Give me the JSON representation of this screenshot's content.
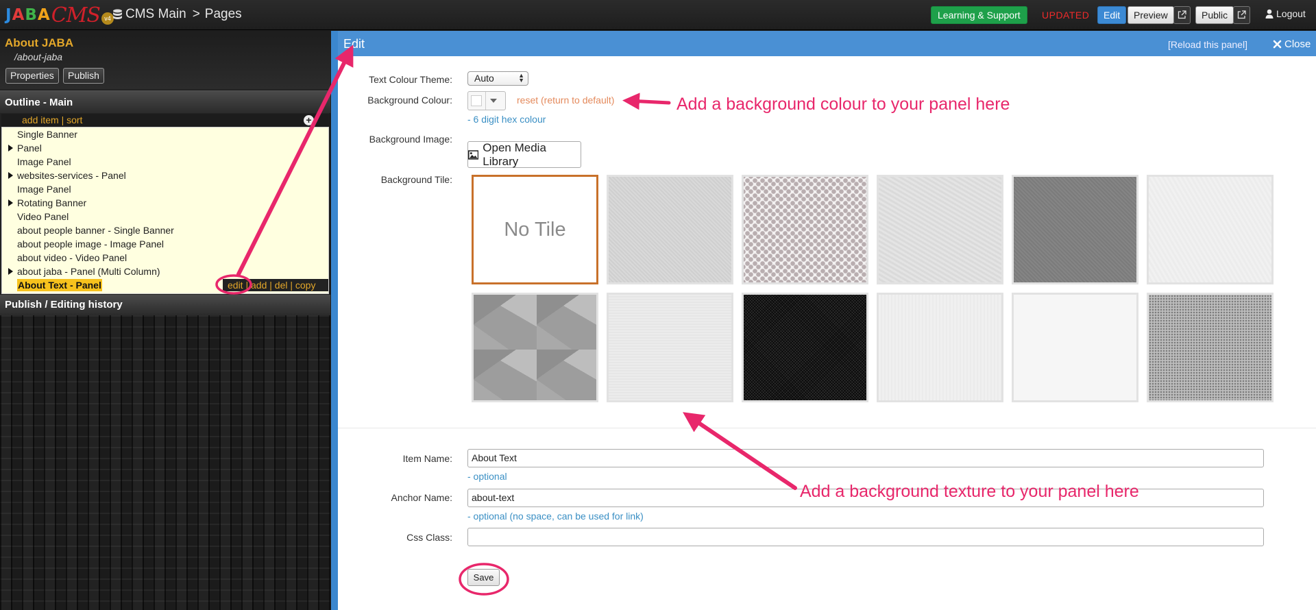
{
  "topbar": {
    "logo": {
      "jaba": "JABA",
      "cms": "CMS",
      "version": "v4"
    },
    "breadcrumb": {
      "section": "CMS Main",
      "separator": ">",
      "current": "Pages"
    },
    "learning_label": "Learning & Support",
    "status": "UPDATED",
    "edit_label": "Edit",
    "preview_label": "Preview",
    "public_label": "Public",
    "logout_label": "Logout"
  },
  "sidebar": {
    "page_title": "About JABA",
    "page_path": "/about-jaba",
    "properties_label": "Properties",
    "publish_label": "Publish",
    "outline_title": "Outline - Main",
    "outline_tools": "add item | sort",
    "items": [
      {
        "label": "Single Banner",
        "expandable": false
      },
      {
        "label": "Panel",
        "expandable": true
      },
      {
        "label": "Image Panel",
        "expandable": false
      },
      {
        "label": "websites-services - Panel",
        "expandable": true
      },
      {
        "label": "Image Panel",
        "expandable": false
      },
      {
        "label": "Rotating Banner",
        "expandable": true
      },
      {
        "label": "Video Panel",
        "expandable": false
      },
      {
        "label": "about people banner - Single Banner",
        "expandable": false
      },
      {
        "label": "about people image - Image Panel",
        "expandable": false
      },
      {
        "label": "about video - Video Panel",
        "expandable": false
      },
      {
        "label": "about jaba - Panel (Multi Column)",
        "expandable": true
      },
      {
        "label": "About Text - Panel",
        "expandable": false,
        "selected": true
      }
    ],
    "row_actions": {
      "edit": "edit",
      "add": "add",
      "del": "del",
      "copy": "copy",
      "sep": " | "
    },
    "history_title": "Publish / Editing history"
  },
  "panel": {
    "title": "Edit",
    "reload_label": "[Reload this panel]",
    "close_label": "Close",
    "text_colour_theme": {
      "label": "Text Colour Theme:",
      "value": "Auto"
    },
    "background_colour": {
      "label": "Background Colour:",
      "reset": "reset (return to default)",
      "hint": "- 6 digit hex colour"
    },
    "background_image": {
      "label": "Background Image:",
      "button": "Open Media Library"
    },
    "background_tile": {
      "label": "Background Tile:",
      "no_tile": "No Tile",
      "selected_index": 0,
      "tile_count": 12
    },
    "item_name": {
      "label": "Item Name:",
      "value": "About Text",
      "hint": "- optional"
    },
    "anchor_name": {
      "label": "Anchor Name:",
      "value": "about-text",
      "hint": "- optional (no space, can be used for link)"
    },
    "css_class": {
      "label": "Css Class:",
      "value": ""
    },
    "save_label": "Save"
  },
  "annotations": {
    "colour": "Add a background colour to your panel here",
    "texture": "Add a background texture to your panel here",
    "color": "#e8276b"
  },
  "colors": {
    "accent": "#4a90d4",
    "success": "#1ea04a",
    "status": "#ef2a2a",
    "sidebar_title": "#e3a72a",
    "outline_bg": "#ffffe0",
    "selected_tile": "#c8712a"
  }
}
